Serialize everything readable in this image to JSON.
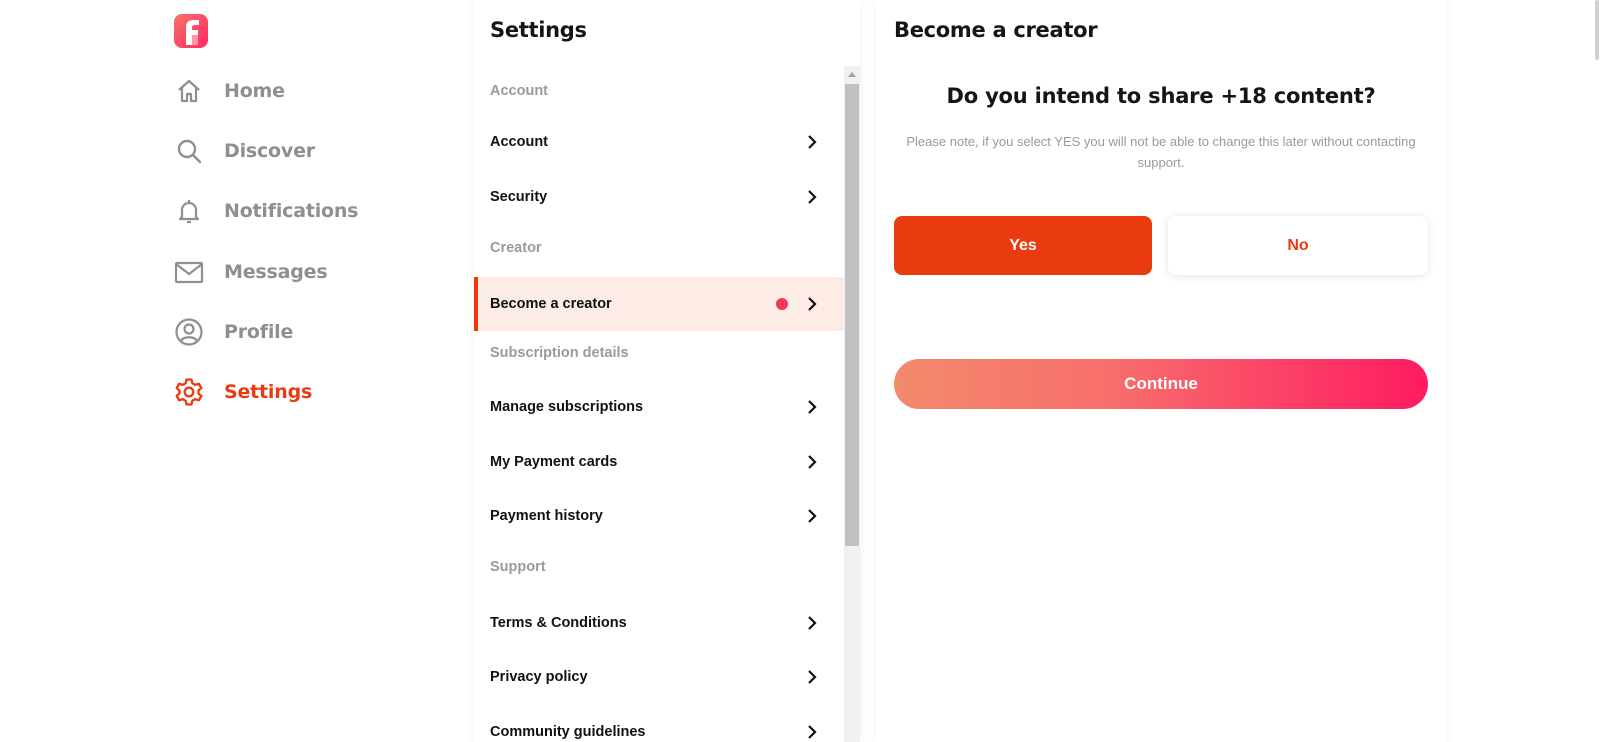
{
  "nav": {
    "logo_icon": "app-logo",
    "items": [
      {
        "label": "Home",
        "icon": "home-icon"
      },
      {
        "label": "Discover",
        "icon": "search-icon"
      },
      {
        "label": "Notifications",
        "icon": "bell-icon"
      },
      {
        "label": "Messages",
        "icon": "mail-icon"
      },
      {
        "label": "Profile",
        "icon": "user-circle-icon"
      },
      {
        "label": "Settings",
        "icon": "gear-icon",
        "active": true
      }
    ]
  },
  "settings": {
    "title": "Settings",
    "sections": {
      "account": {
        "header": "Account",
        "items": [
          "Account",
          "Security"
        ]
      },
      "creator": {
        "header": "Creator",
        "items": [
          "Become a creator"
        ]
      },
      "subscription": {
        "header": "Subscription details",
        "items": [
          "Manage subscriptions",
          "My Payment cards",
          "Payment history"
        ]
      },
      "support": {
        "header": "Support",
        "items": [
          "Terms & Conditions",
          "Privacy policy",
          "Community guidelines"
        ]
      }
    }
  },
  "creator": {
    "title": "Become a creator",
    "question": "Do you intend to share +18 content?",
    "note": "Please note, if you select YES you will not be able to change this later without contacting support.",
    "yes_label": "Yes",
    "no_label": "No",
    "continue_label": "Continue"
  },
  "colors": {
    "accent": "#ea3a10",
    "active_row_bg": "#fdebe5",
    "badge_dot": "#f03a5a",
    "gradient_start": "#f38a6b",
    "gradient_end": "#ff1b61"
  }
}
